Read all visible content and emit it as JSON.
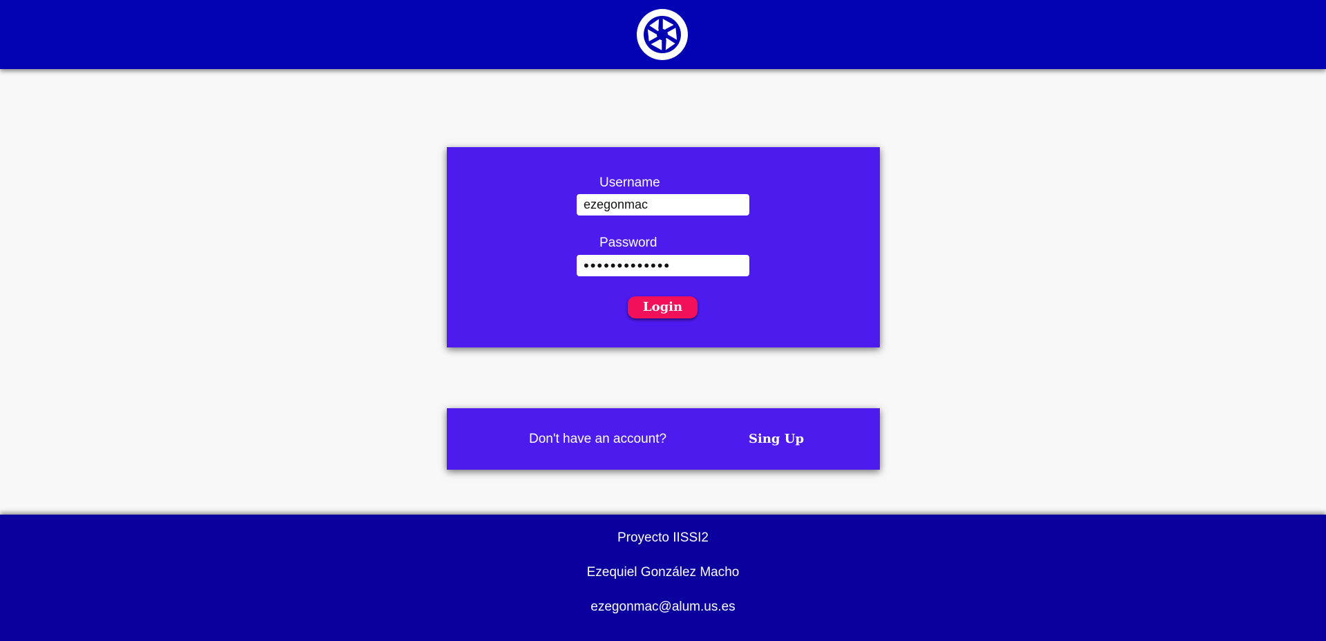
{
  "header": {
    "logo_icon": "camera-shutter-icon"
  },
  "login_form": {
    "username_label": "Username",
    "username_value": "ezegonmac",
    "password_label": "Password",
    "password_value": "•••••••••••••",
    "login_label": "Login"
  },
  "signup": {
    "prompt": "Don't have an account?",
    "link_label": "Sing Up"
  },
  "footer": {
    "project": "Proyecto IISSI2",
    "author": "Ezequiel González Macho",
    "email": "ezegonmac@alum.us.es"
  },
  "colors": {
    "header": "#0303b4",
    "card": "#4d1bee",
    "button": "#f2105a",
    "footer": "#0b009e",
    "background": "#f8f8f8"
  }
}
